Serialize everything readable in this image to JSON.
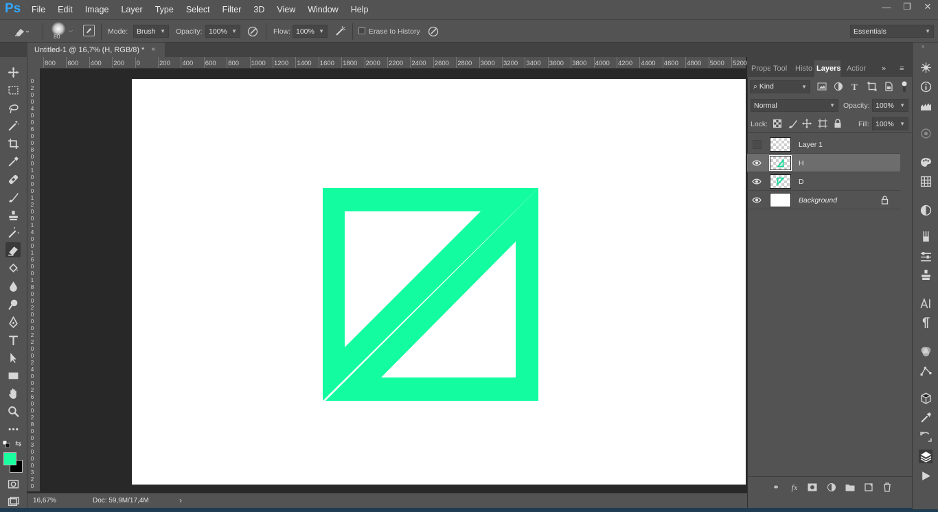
{
  "app": {
    "logo": "Ps",
    "menus": [
      "File",
      "Edit",
      "Image",
      "Layer",
      "Type",
      "Select",
      "Filter",
      "3D",
      "View",
      "Window",
      "Help"
    ],
    "window_controls": [
      "minimize",
      "restore",
      "close"
    ]
  },
  "options": {
    "brush_size": "80",
    "mode_label": "Mode:",
    "mode_value": "Brush",
    "opacity_label": "Opacity:",
    "opacity_value": "100%",
    "flow_label": "Flow:",
    "flow_value": "100%",
    "erase_history_label": "Erase to History",
    "workspace": "Essentials"
  },
  "document": {
    "tab_title": "Untitled-1 @ 16,7% (H, RGB/8) *",
    "close_glyph": "×"
  },
  "ruler": {
    "h_labels": [
      "800",
      "600",
      "400",
      "200",
      "0",
      "200",
      "400",
      "600",
      "800",
      "1000",
      "1200",
      "1400",
      "1600",
      "1800",
      "2000",
      "2200",
      "2400",
      "2600",
      "2800",
      "3000",
      "3200",
      "3400",
      "3600",
      "3800",
      "4000",
      "4200",
      "4400",
      "4600",
      "4800",
      "5000",
      "5200"
    ],
    "v_labels": [
      "0",
      "2",
      "0",
      "0",
      "4",
      "0",
      "0",
      "6",
      "0",
      "0",
      "8",
      "0",
      "0",
      "1",
      "0",
      "0",
      "0",
      "1",
      "2",
      "0",
      "0",
      "1",
      "4",
      "0",
      "0",
      "1",
      "6",
      "0",
      "0",
      "1",
      "8",
      "0",
      "0",
      "2",
      "0",
      "0",
      "0",
      "2",
      "2",
      "0",
      "0",
      "2",
      "4",
      "0",
      "0",
      "2",
      "6",
      "0",
      "0",
      "2",
      "8",
      "0",
      "0",
      "3",
      "0",
      "0",
      "0",
      "3",
      "2",
      "0",
      "0"
    ]
  },
  "status": {
    "zoom": "16,67%",
    "doc_info": "Doc: 59,9M/17,4M",
    "expand_glyph": "›"
  },
  "colors": {
    "foreground": "#19ffa0",
    "background": "#000000",
    "accent": "#31a8ff",
    "shape": "#14fca0"
  },
  "panels": {
    "tabs": [
      "Prope",
      "Tool",
      "Histo",
      "Layers",
      "Actior"
    ],
    "active_tab": "Layers",
    "filter_kind": "Kind",
    "blend_mode": "Normal",
    "opacity_label": "Opacity:",
    "opacity_value": "100%",
    "lock_label": "Lock:",
    "fill_label": "Fill:",
    "fill_value": "100%",
    "layers": [
      {
        "name": "Layer 1",
        "visible": false,
        "selected": false
      },
      {
        "name": "H",
        "visible": true,
        "selected": true
      },
      {
        "name": "D",
        "visible": true,
        "selected": false
      },
      {
        "name": "Background",
        "visible": true,
        "selected": false,
        "locked": true
      }
    ]
  }
}
